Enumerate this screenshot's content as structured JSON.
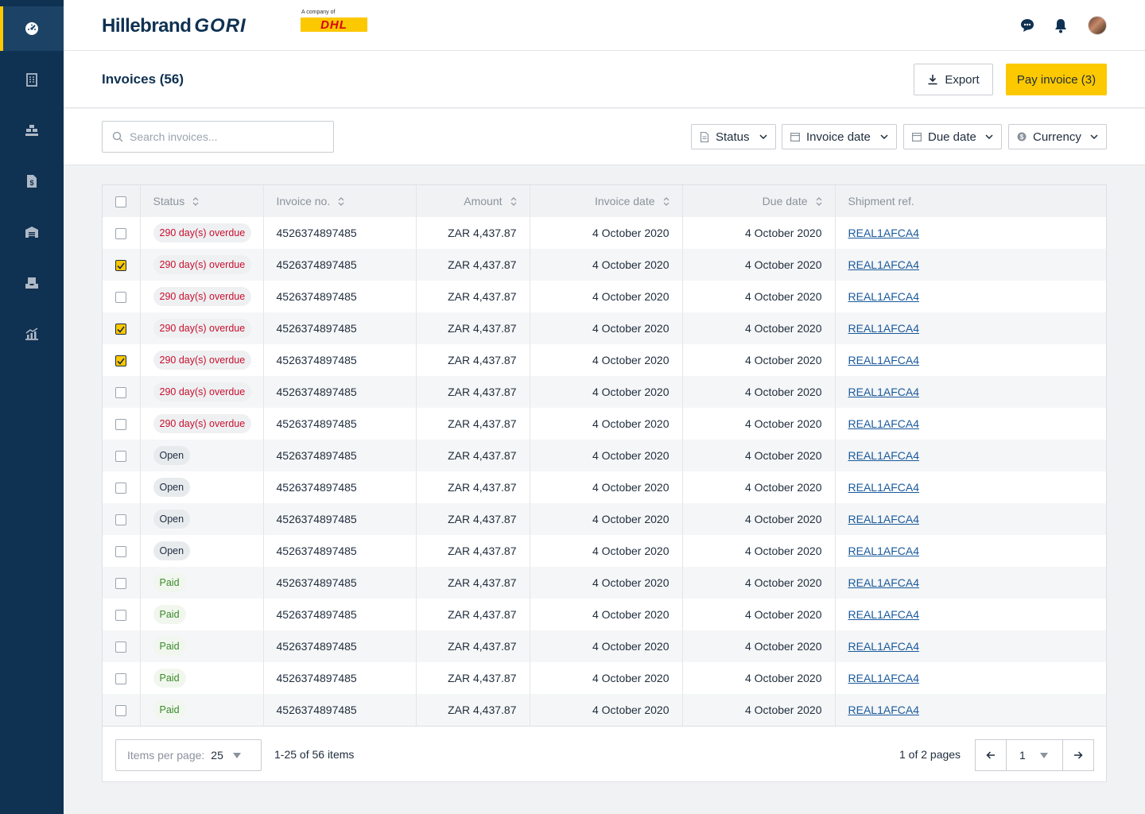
{
  "sidebar": {
    "items": [
      {
        "icon": "dashboard-icon",
        "active": true
      },
      {
        "icon": "building-icon",
        "active": false
      },
      {
        "icon": "containers-icon",
        "active": false
      },
      {
        "icon": "invoice-dollar-icon",
        "active": false
      },
      {
        "icon": "warehouse-icon",
        "active": false
      },
      {
        "icon": "inbox-tray-icon",
        "active": false
      },
      {
        "icon": "analytics-chart-icon",
        "active": false
      }
    ]
  },
  "header": {
    "logo_main": "Hillebrand",
    "logo_accent": "GORI",
    "dhl_caption": "A company of",
    "dhl_wordmark": "DHL",
    "icons": [
      "chat-icon",
      "bell-icon",
      "avatar"
    ]
  },
  "page": {
    "title": "Invoices (56)",
    "export_label": "Export",
    "pay_label": "Pay invoice (3)"
  },
  "filters": {
    "search_placeholder": "Search invoices...",
    "status": "Status",
    "invoice_date": "Invoice date",
    "due_date": "Due date",
    "currency": "Currency"
  },
  "table": {
    "columns": [
      "Status",
      "Invoice no.",
      "Amount",
      "Invoice date",
      "Due date",
      "Shipment ref."
    ],
    "rows": [
      {
        "checked": false,
        "status": "290 day(s) overdue",
        "status_type": "overdue",
        "invoice_no": "4526374897485",
        "amount": "ZAR 4,437.87",
        "invoice_date": "4 October 2020",
        "due_date": "4 October 2020",
        "shipment_ref": "REAL1AFCA4"
      },
      {
        "checked": true,
        "status": "290 day(s) overdue",
        "status_type": "overdue",
        "invoice_no": "4526374897485",
        "amount": "ZAR 4,437.87",
        "invoice_date": "4 October 2020",
        "due_date": "4 October 2020",
        "shipment_ref": "REAL1AFCA4"
      },
      {
        "checked": false,
        "status": "290 day(s) overdue",
        "status_type": "overdue",
        "invoice_no": "4526374897485",
        "amount": "ZAR 4,437.87",
        "invoice_date": "4 October 2020",
        "due_date": "4 October 2020",
        "shipment_ref": "REAL1AFCA4"
      },
      {
        "checked": true,
        "status": "290 day(s) overdue",
        "status_type": "overdue",
        "invoice_no": "4526374897485",
        "amount": "ZAR 4,437.87",
        "invoice_date": "4 October 2020",
        "due_date": "4 October 2020",
        "shipment_ref": "REAL1AFCA4"
      },
      {
        "checked": true,
        "status": "290 day(s) overdue",
        "status_type": "overdue",
        "invoice_no": "4526374897485",
        "amount": "ZAR 4,437.87",
        "invoice_date": "4 October 2020",
        "due_date": "4 October 2020",
        "shipment_ref": "REAL1AFCA4"
      },
      {
        "checked": false,
        "status": "290 day(s) overdue",
        "status_type": "overdue",
        "invoice_no": "4526374897485",
        "amount": "ZAR 4,437.87",
        "invoice_date": "4 October 2020",
        "due_date": "4 October 2020",
        "shipment_ref": "REAL1AFCA4"
      },
      {
        "checked": false,
        "status": "290 day(s) overdue",
        "status_type": "overdue",
        "invoice_no": "4526374897485",
        "amount": "ZAR 4,437.87",
        "invoice_date": "4 October 2020",
        "due_date": "4 October 2020",
        "shipment_ref": "REAL1AFCA4"
      },
      {
        "checked": false,
        "status": "Open",
        "status_type": "open",
        "invoice_no": "4526374897485",
        "amount": "ZAR 4,437.87",
        "invoice_date": "4 October 2020",
        "due_date": "4 October 2020",
        "shipment_ref": "REAL1AFCA4"
      },
      {
        "checked": false,
        "status": "Open",
        "status_type": "open",
        "invoice_no": "4526374897485",
        "amount": "ZAR 4,437.87",
        "invoice_date": "4 October 2020",
        "due_date": "4 October 2020",
        "shipment_ref": "REAL1AFCA4"
      },
      {
        "checked": false,
        "status": "Open",
        "status_type": "open",
        "invoice_no": "4526374897485",
        "amount": "ZAR 4,437.87",
        "invoice_date": "4 October 2020",
        "due_date": "4 October 2020",
        "shipment_ref": "REAL1AFCA4"
      },
      {
        "checked": false,
        "status": "Open",
        "status_type": "open",
        "invoice_no": "4526374897485",
        "amount": "ZAR 4,437.87",
        "invoice_date": "4 October 2020",
        "due_date": "4 October 2020",
        "shipment_ref": "REAL1AFCA4"
      },
      {
        "checked": false,
        "status": "Paid",
        "status_type": "paid",
        "invoice_no": "4526374897485",
        "amount": "ZAR 4,437.87",
        "invoice_date": "4 October 2020",
        "due_date": "4 October 2020",
        "shipment_ref": "REAL1AFCA4"
      },
      {
        "checked": false,
        "status": "Paid",
        "status_type": "paid",
        "invoice_no": "4526374897485",
        "amount": "ZAR 4,437.87",
        "invoice_date": "4 October 2020",
        "due_date": "4 October 2020",
        "shipment_ref": "REAL1AFCA4"
      },
      {
        "checked": false,
        "status": "Paid",
        "status_type": "paid",
        "invoice_no": "4526374897485",
        "amount": "ZAR 4,437.87",
        "invoice_date": "4 October 2020",
        "due_date": "4 October 2020",
        "shipment_ref": "REAL1AFCA4"
      },
      {
        "checked": false,
        "status": "Paid",
        "status_type": "paid",
        "invoice_no": "4526374897485",
        "amount": "ZAR 4,437.87",
        "invoice_date": "4 October 2020",
        "due_date": "4 October 2020",
        "shipment_ref": "REAL1AFCA4"
      },
      {
        "checked": false,
        "status": "Paid",
        "status_type": "paid",
        "invoice_no": "4526374897485",
        "amount": "ZAR 4,437.87",
        "invoice_date": "4 October 2020",
        "due_date": "4 October 2020",
        "shipment_ref": "REAL1AFCA4"
      }
    ]
  },
  "pagination": {
    "items_per_page_label": "Items per page:",
    "items_per_page_value": "25",
    "range_text": "1-25 of 56 items",
    "pages_text": "1 of 2 pages",
    "current_page": "1"
  },
  "colors": {
    "sidebar_bg": "#0f3152",
    "accent_yellow": "#fcc800",
    "overdue_text": "#c8102e",
    "paid_text": "#3a8a2a",
    "link": "#1a5a9c"
  }
}
